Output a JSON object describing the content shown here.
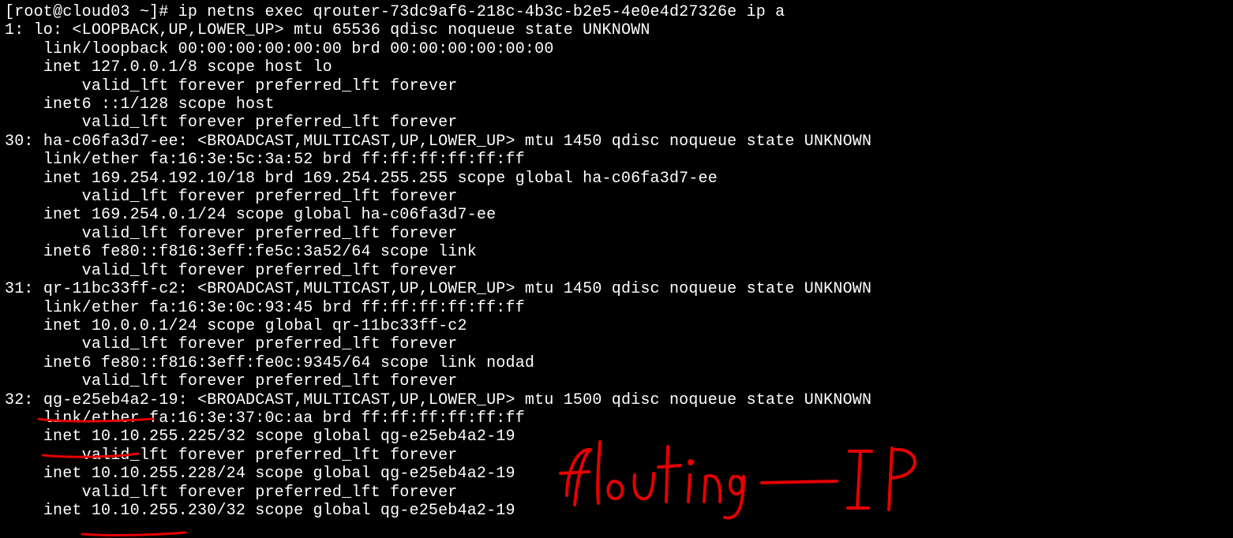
{
  "prompt": "[root@cloud03 ~]# ",
  "command": "ip netns exec qrouter-73dc9af6-218c-4b3c-b2e5-4e0e4d27326e ip a",
  "annotation": {
    "text": "flouting — IP",
    "color": "#e60000"
  },
  "interfaces": [
    {
      "idx": "1",
      "name": "lo",
      "flags": "<LOOPBACK,UP,LOWER_UP>",
      "tail": "mtu 65536 qdisc noqueue state UNKNOWN",
      "lines": [
        "link/loopback 00:00:00:00:00:00 brd 00:00:00:00:00:00",
        "inet 127.0.0.1/8 scope host lo",
        "    valid_lft forever preferred_lft forever",
        "inet6 ::1/128 scope host",
        "    valid_lft forever preferred_lft forever"
      ]
    },
    {
      "idx": "30",
      "name": "ha-c06fa3d7-ee",
      "flags": "<BROADCAST,MULTICAST,UP,LOWER_UP>",
      "tail": "mtu 1450 qdisc noqueue state UNKNOWN",
      "lines": [
        "link/ether fa:16:3e:5c:3a:52 brd ff:ff:ff:ff:ff:ff",
        "inet 169.254.192.10/18 brd 169.254.255.255 scope global ha-c06fa3d7-ee",
        "    valid_lft forever preferred_lft forever",
        "inet 169.254.0.1/24 scope global ha-c06fa3d7-ee",
        "    valid_lft forever preferred_lft forever",
        "inet6 fe80::f816:3eff:fe5c:3a52/64 scope link",
        "    valid_lft forever preferred_lft forever"
      ]
    },
    {
      "idx": "31",
      "name": "qr-11bc33ff-c2",
      "flags": "<BROADCAST,MULTICAST,UP,LOWER_UP>",
      "tail": "mtu 1450 qdisc noqueue state UNKNOWN",
      "lines": [
        "link/ether fa:16:3e:0c:93:45 brd ff:ff:ff:ff:ff:ff",
        "inet 10.0.0.1/24 scope global qr-11bc33ff-c2",
        "    valid_lft forever preferred_lft forever",
        "inet6 fe80::f816:3eff:fe0c:9345/64 scope link nodad",
        "    valid_lft forever preferred_lft forever"
      ]
    },
    {
      "idx": "32",
      "name": "qg-e25eb4a2-19",
      "flags": "<BROADCAST,MULTICAST,UP,LOWER_UP>",
      "tail": "mtu 1500 qdisc noqueue state UNKNOWN",
      "lines": [
        "link/ether fa:16:3e:37:0c:aa brd ff:ff:ff:ff:ff:ff",
        "inet 10.10.255.225/32 scope global qg-e25eb4a2-19",
        "    valid_lft forever preferred_lft forever",
        "inet 10.10.255.228/24 scope global qg-e25eb4a2-19",
        "    valid_lft forever preferred_lft forever",
        "inet 10.10.255.230/32 scope global qg-e25eb4a2-19"
      ]
    }
  ]
}
